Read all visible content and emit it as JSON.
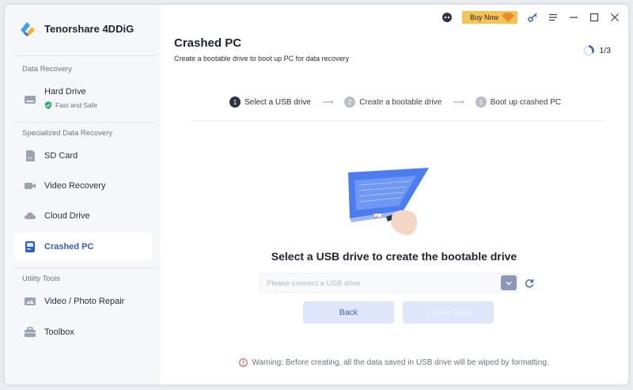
{
  "app": {
    "brand": "Tenorshare 4DDiG"
  },
  "topbar": {
    "buy_now": "Buy Now"
  },
  "sidebar": {
    "sections": {
      "data_recovery": "Data Recovery",
      "specialized": "Specialized Data Recovery",
      "utility": "Utility Tools"
    },
    "items": {
      "hard_drive": {
        "label": "Hard Drive",
        "sub": "Fast and Safe"
      },
      "sd_card": {
        "label": "SD Card"
      },
      "video_recovery": {
        "label": "Video Recovery"
      },
      "cloud_drive": {
        "label": "Cloud Drive"
      },
      "crashed_pc": {
        "label": "Crashed PC"
      },
      "video_photo_repair": {
        "label": "Video / Photo Repair"
      },
      "toolbox": {
        "label": "Toolbox"
      }
    },
    "active": "crashed_pc"
  },
  "main": {
    "title": "Crashed PC",
    "subtitle": "Create a bootable drive to boot up PC for data recovery",
    "progress": "1/3",
    "steps": [
      {
        "num": "1",
        "label": "Select a USB drive"
      },
      {
        "num": "2",
        "label": "Create a bootable drive"
      },
      {
        "num": "3",
        "label": "Boot up crashed PC"
      }
    ],
    "heading": "Select a USB drive to create the bootable drive",
    "select_placeholder": "Please connect a USB drive",
    "back_label": "Back",
    "create_label": "Create Now",
    "warning": "Warning: Before creating, all the data saved in USB drive will be wiped by formatting."
  },
  "colors": {
    "accent": "#2f5ec8",
    "buy_now": "#f6c255",
    "warning": "#e0553a"
  }
}
